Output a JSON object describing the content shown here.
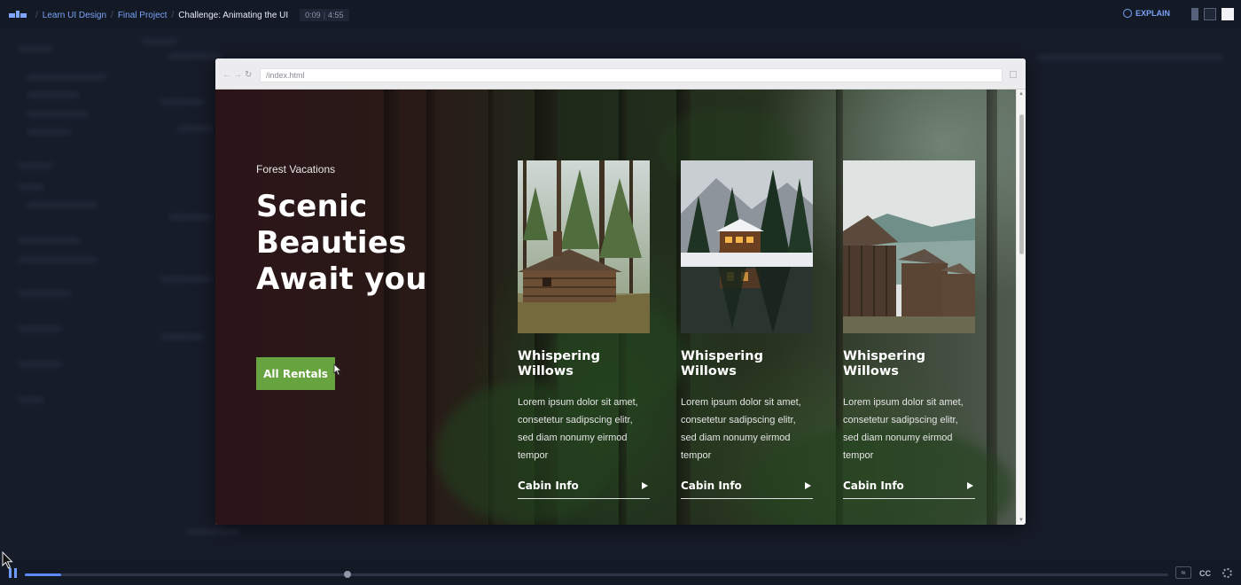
{
  "topbar": {
    "breadcrumbs": [
      "Learn UI Design",
      "Final Project",
      "Challenge: Animating the UI"
    ],
    "timer_current": "0:09",
    "timer_total": "4:55",
    "explain_label": "EXPLAIN"
  },
  "browser": {
    "url": "/index.html"
  },
  "hero": {
    "tagline": "Forest Vacations",
    "headline": [
      "Scenic",
      "Beauties",
      "Await you"
    ],
    "cta_label": "All Rentals"
  },
  "cards": [
    {
      "title": "Whispering Willows",
      "text": "Lorem ipsum dolor sit amet, consetetur sadipscing elitr, sed diam nonumy eirmod tempor",
      "link": "Cabin Info"
    },
    {
      "title": "Whispering Willows",
      "text": "Lorem ipsum dolor sit amet, consetetur sadipscing elitr, sed diam nonumy eirmod tempor",
      "link": "Cabin Info"
    },
    {
      "title": "Whispering Willows",
      "text": "Lorem ipsum dolor sit amet, consetetur sadipscing elitr, sed diam nonumy eirmod tempor",
      "link": "Cabin Info"
    }
  ],
  "player": {
    "progress": 0.032,
    "cc_label": "CC"
  },
  "colors": {
    "accent": "#67a43f",
    "link_blue": "#7aa3f5",
    "app_bg": "#171c29"
  }
}
